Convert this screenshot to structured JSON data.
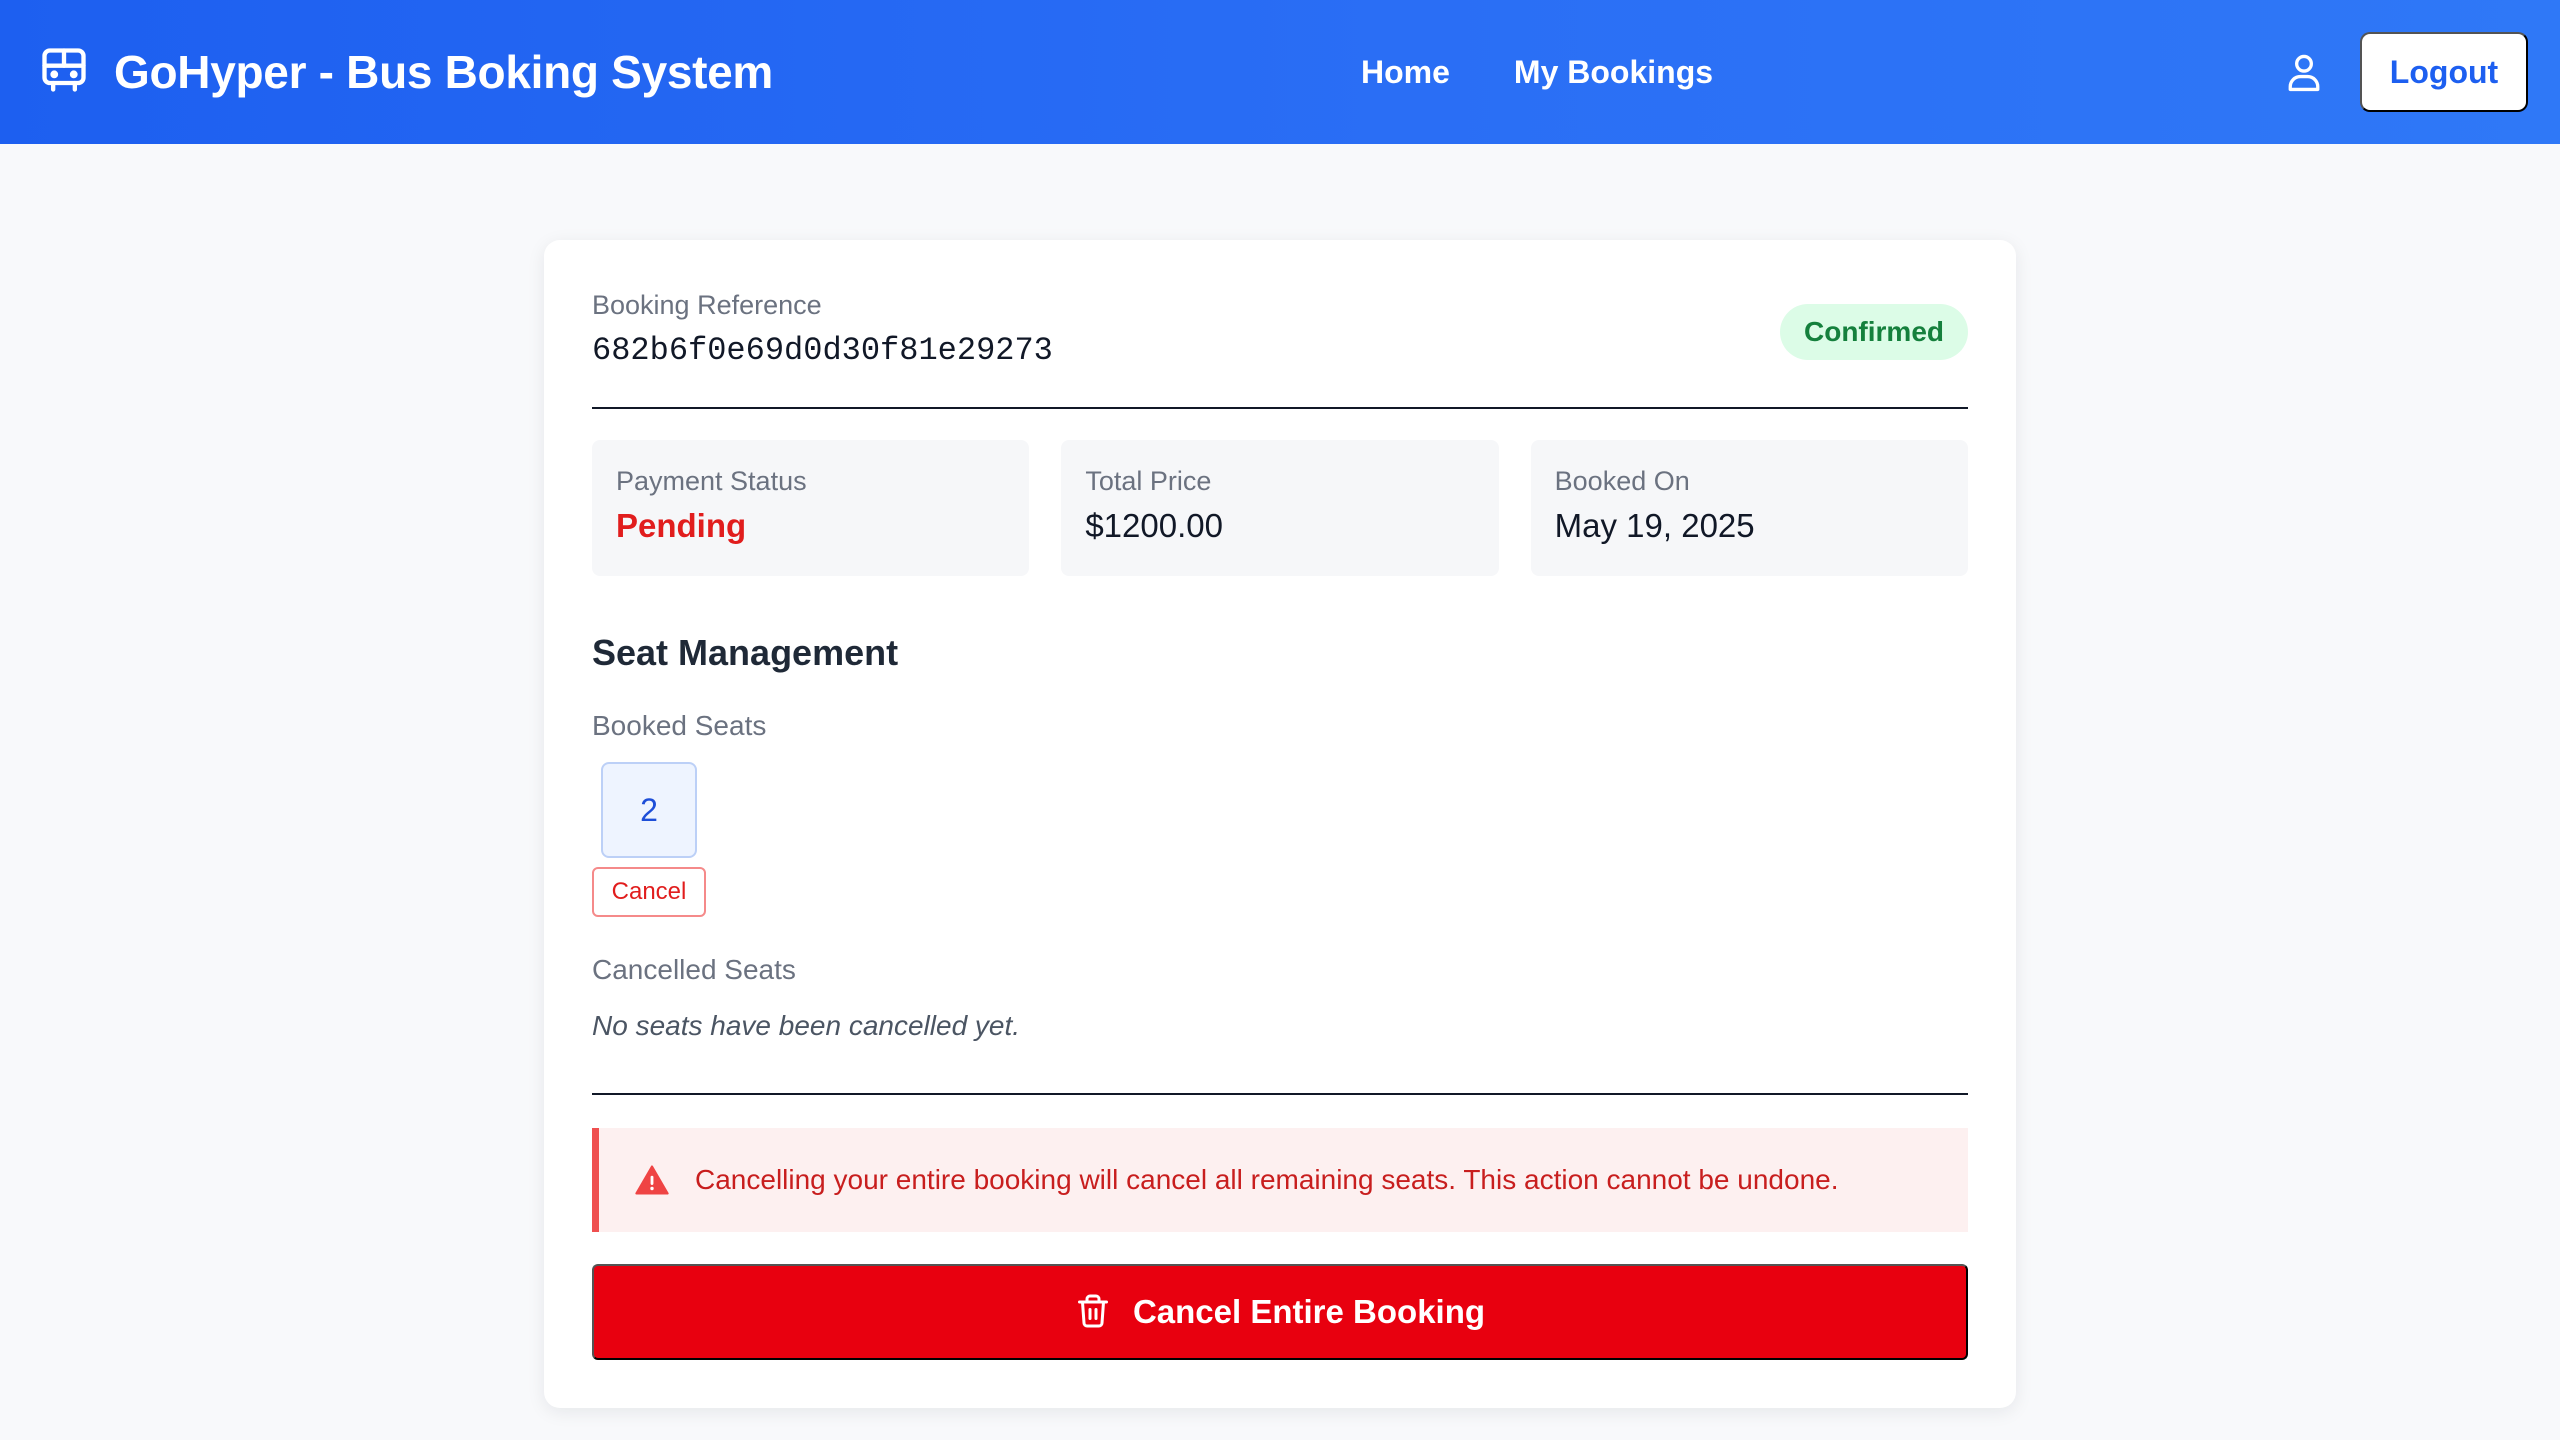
{
  "header": {
    "brand_icon": "bus-icon",
    "title": "GoHyper - Bus Boking System",
    "nav": [
      {
        "label": "Home"
      },
      {
        "label": "My Bookings"
      }
    ],
    "user_icon": "user-icon",
    "logout_label": "Logout"
  },
  "booking": {
    "reference_label": "Booking Reference",
    "reference_value": "682b6f0e69d0d30f81e29273",
    "status": "Confirmed",
    "info": [
      {
        "label": "Payment Status",
        "value": "Pending"
      },
      {
        "label": "Total Price",
        "value": "$1200.00"
      },
      {
        "label": "Booked On",
        "value": "May 19, 2025"
      }
    ]
  },
  "seats": {
    "section_title": "Seat Management",
    "booked_label": "Booked Seats",
    "booked": [
      {
        "number": "2",
        "cancel_label": "Cancel"
      }
    ],
    "cancelled_label": "Cancelled Seats",
    "cancelled_empty_note": "No seats have been cancelled yet."
  },
  "warning": {
    "icon": "warning-triangle-icon",
    "text": "Cancelling your entire booking will cancel all remaining seats. This action cannot be undone."
  },
  "actions": {
    "cancel_all_icon": "trash-icon",
    "cancel_all_label": "Cancel Entire Booking"
  },
  "colors": {
    "header_start": "#1d5ff0",
    "header_end": "#2f78f7",
    "confirmed_bg": "#dcfce7",
    "confirmed_text": "#15803d",
    "pending_text": "#e11d1d",
    "danger": "#e8000f"
  }
}
